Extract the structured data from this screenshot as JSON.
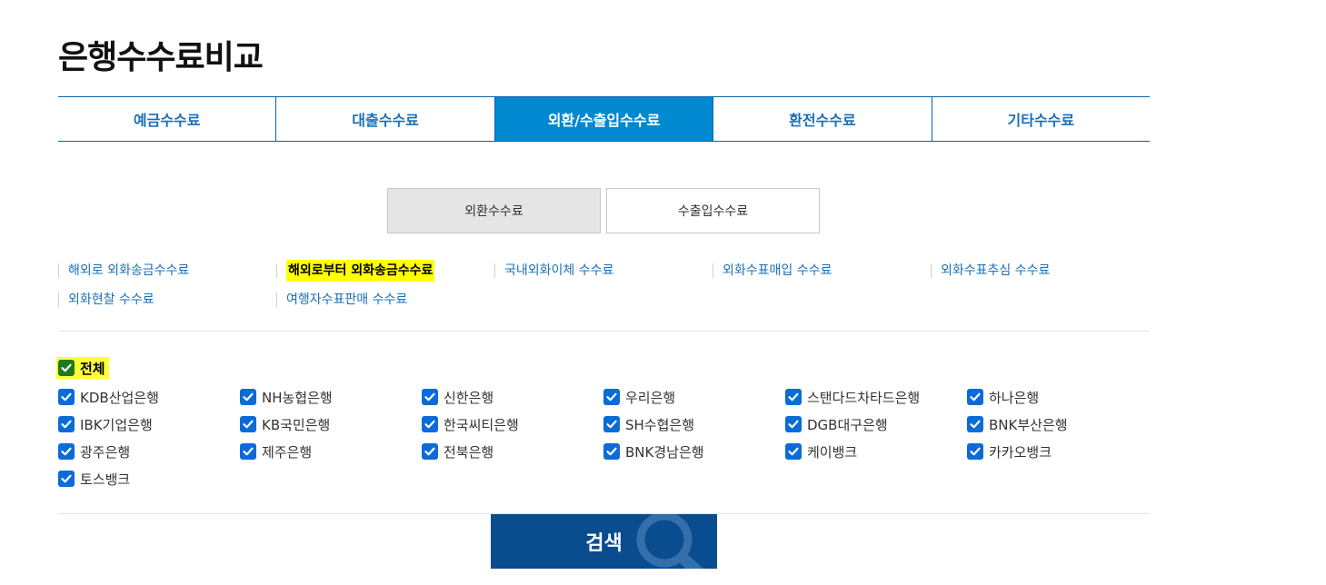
{
  "page": {
    "title": "은행수수료비교"
  },
  "main_tabs": [
    {
      "label": "예금수수료",
      "active": false
    },
    {
      "label": "대출수수료",
      "active": false
    },
    {
      "label": "외환/수출입수수료",
      "active": true
    },
    {
      "label": "환전수수료",
      "active": false
    },
    {
      "label": "기타수수료",
      "active": false
    }
  ],
  "sub_tabs": [
    {
      "label": "외환수수료",
      "active": true
    },
    {
      "label": "수출입수수료",
      "active": false
    }
  ],
  "fee_links": [
    "해외로 외화송금수수료",
    "해외로부터 외화송금수수료",
    "국내외화이체 수수료",
    "외화수표매입 수수료",
    "외화수표추심 수수료",
    "외화현찰 수수료",
    "여행자수표판매 수수료"
  ],
  "active_fee_link": 1,
  "all_checkbox": {
    "label": "전체",
    "checked": true
  },
  "banks": [
    "KDB산업은행",
    "NH농협은행",
    "신한은행",
    "우리은행",
    "스탠다드차타드은행",
    "하나은행",
    "IBK기업은행",
    "KB국민은행",
    "한국씨티은행",
    "SH수협은행",
    "DGB대구은행",
    "BNK부산은행",
    "광주은행",
    "제주은행",
    "전북은행",
    "BNK경남은행",
    "케이뱅크",
    "카카오뱅크",
    "토스뱅크"
  ],
  "search_button": {
    "label": "검색"
  },
  "colors": {
    "tab_active": "#0088d1",
    "link": "#1a70b8",
    "checkbox": "#0b6bd8",
    "search": "#0a4d8f",
    "highlight": "#ffff00"
  },
  "icons": {
    "checkbox": "checkmark-icon",
    "search": "magnifier-icon"
  }
}
